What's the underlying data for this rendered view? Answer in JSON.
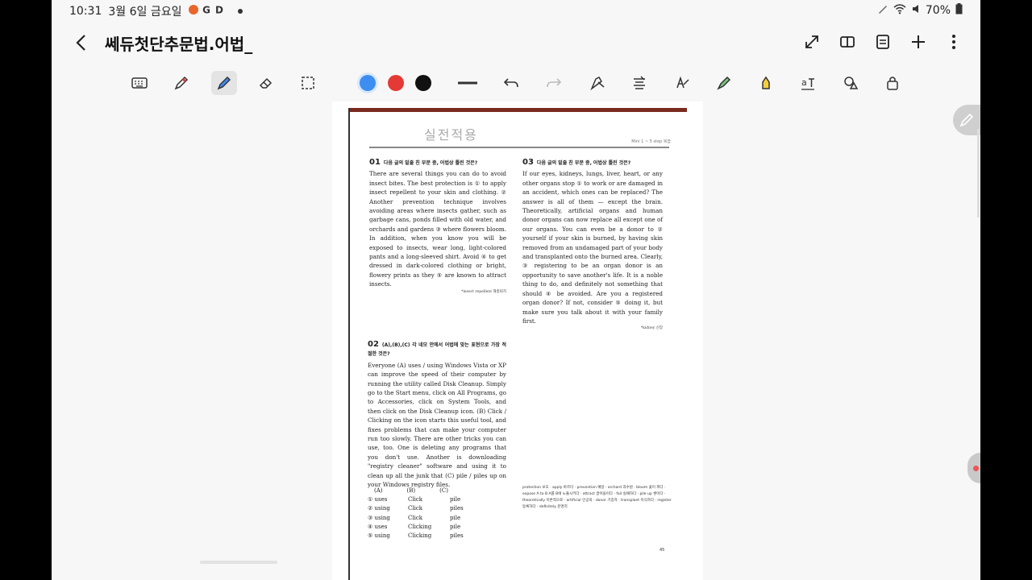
{
  "status": {
    "time": "10:31",
    "date": "3월 6일 금요일",
    "battery": "70%"
  },
  "app": {
    "title": "쎄듀첫단추문법.어법_"
  },
  "toolbar": {
    "colors": [
      "#3d8ef0",
      "#e53935",
      "#111111"
    ]
  },
  "doc": {
    "heading": "실전적용",
    "page_code": "Mini 1 ~ 5 step 복습",
    "q1": {
      "num": "01",
      "prompt": "다음 글의 밑줄 친 부분 중, 어법상 틀린 것은?",
      "body": "There are several things you can do to avoid insect bites. The best protection is ① to apply insect repellent to your skin and clothing. ② Another prevention technique involves avoiding areas where insects gather, such as garbage cans, ponds filled with old water, and orchards and gardens ③ where flowers bloom. In addition, when you know you will be exposed to insects, wear long, light-colored pants and a long-sleeved shirt. Avoid ④ to get dressed in dark-colored clothing or bright, flowery prints as they ⑤ are known to attract insects.",
      "note": "*insect repellent 해충퇴치"
    },
    "q3": {
      "num": "03",
      "prompt": "다음 글의 밑줄 친 부분 중, 어법상 틀린 것은?",
      "body": "If our eyes, kidneys, lungs, liver, heart, or any other organs stop ① to work or are damaged in an accident, which ones can be replaced? The answer is all of them — except the brain. Theoretically, artificial organs and human donor organs can now replace all except one of our organs. You can even be a donor to ② yourself if your skin is burned, by having skin removed from an undamaged part of your body and transplanted onto the burned area. Clearly, ③ registering to be an organ donor is an opportunity to save another's life. It is a noble thing to do, and definitely not something that should ④ be avoided. Are you a registered organ donor? If not, consider ⑤ doing it, but make sure you talk about it with your family first.",
      "note": "*kidney 신장"
    },
    "q2": {
      "num": "02",
      "prompt": "(A),(B),(C) 각 네모 안에서 어법에 맞는 표현으로 가장 적절한 것은?",
      "body": "Everyone (A) uses / using Windows Vista or XP can improve the speed of their computer by running the utility called Disk Cleanup. Simply go to the Start menu, click on All Programs, go to Accessories, click on System Tools, and then click on the Disk Cleanup icon. (B) Click / Clicking on the icon starts this useful tool, and fixes problems that can make your computer run too slowly. There are other tricks you can use, too. One is deleting any programs that you don't use. Another is downloading \"registry cleaner\" software and using it to clean up all the junk that (C) pile / piles up on your Windows registry files."
    },
    "answers": {
      "header": [
        "(A)",
        "(B)",
        "(C)"
      ],
      "rows": [
        [
          "① uses",
          "Click",
          "pile"
        ],
        [
          "② using",
          "Click",
          "piles"
        ],
        [
          "③ using",
          "Click",
          "pile"
        ],
        [
          "④ uses",
          "Clicking",
          "pile"
        ],
        [
          "⑤ using",
          "Clicking",
          "piles"
        ]
      ]
    },
    "vocab": "protection 보호 · apply 바르다 · prevention 예방 · orchard 과수원 · bloom 꽃이 피다 · expose A to B A를 B에 노출시키다 · attract 끌어들이다 · fail 실패하다 · pile up 쌓이다 · theoretically 이론적으로 · artificial 인공의 · donor 기증자 · transplant 이식하다 · register 등록하다 · definitely 분명히",
    "folio": "45"
  }
}
